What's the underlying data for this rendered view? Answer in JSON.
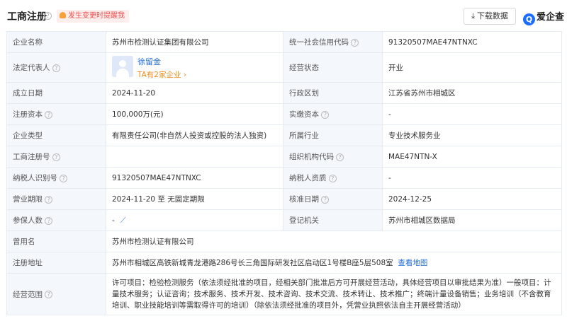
{
  "header": {
    "title": "工商注册",
    "notify_label": "发生变更时提醒我",
    "download_label": "下载数据",
    "brand_name": "爱企查",
    "brand_logo_letter": "Q"
  },
  "rows": {
    "company_name": {
      "label": "企业名称",
      "value": "苏州市检测认证集团有限公司"
    },
    "credit_code": {
      "label": "统一社会信用代码",
      "value": "91320507MAE47NTNXC"
    },
    "legal_rep": {
      "label": "法定代表人",
      "name": "徐留金",
      "sub": "TA有2家企业 ›"
    },
    "status": {
      "label": "经营状态",
      "value": "开业"
    },
    "established": {
      "label": "成立日期",
      "value": "2024-11-20"
    },
    "district": {
      "label": "行政区划",
      "value": "江苏省苏州市相城区"
    },
    "reg_capital": {
      "label": "注册资本",
      "value": "100,000万(元)"
    },
    "paid_capital": {
      "label": "实缴资本",
      "value": "-"
    },
    "company_type": {
      "label": "企业类型",
      "value": "有限责任公司(非自然人投资或控股的法人独资)"
    },
    "industry": {
      "label": "所属行业",
      "value": "专业技术服务业"
    },
    "reg_no": {
      "label": "工商注册号",
      "value": ""
    },
    "org_code": {
      "label": "组织机构代码",
      "value": "MAE47NTN-X"
    },
    "taxpayer_id": {
      "label": "纳税人识别号",
      "value": "91320507MAE47NTNXC"
    },
    "taxpayer_qual": {
      "label": "纳税人资质",
      "value": "-"
    },
    "term": {
      "label": "营业期限",
      "value": "2024-11-20 至 无固定期限"
    },
    "approval_date": {
      "label": "核准日期",
      "value": "2024-12-25"
    },
    "insured": {
      "label": "参保人数",
      "value": "-"
    },
    "authority": {
      "label": "登记机关",
      "value": "苏州市相城区数据局"
    },
    "former_name": {
      "label": "曾用名",
      "value": "苏州市检测认证有限公司"
    },
    "address": {
      "label": "注册地址",
      "value": "苏州市相城区高铁新城青龙港路286号长三角国际研发社区启动区1号楼B座5层508室",
      "map_link": "查看地图"
    },
    "scope": {
      "label": "经营范围",
      "value": "许可项目：检验检测服务（依法须经批准的项目，经相关部门批准后方可开展经营活动，具体经营项目以审批结果为准）一般项目：计量技术服务；认证咨询；技术服务、技术开发、技术咨询、技术交流、技术转让、技术推广；终端计量设备销售；业务培训（不含教育培训、职业技能培训等需取得许可的培训）（除依法须经批准的项目外，凭营业执照依法自主开展经营活动）"
    }
  },
  "icons": {
    "help": "question-circle-icon",
    "bell": "bell-icon",
    "download": "download-icon",
    "trend": "trend-chart-icon"
  },
  "colors": {
    "link": "#1f6bd6",
    "label_bg": "#f4f7fc",
    "notify_text": "#f04c4c",
    "notify_bg": "#fdeeee",
    "sub_link": "#f28a1c",
    "brand": "#1a6dff"
  }
}
